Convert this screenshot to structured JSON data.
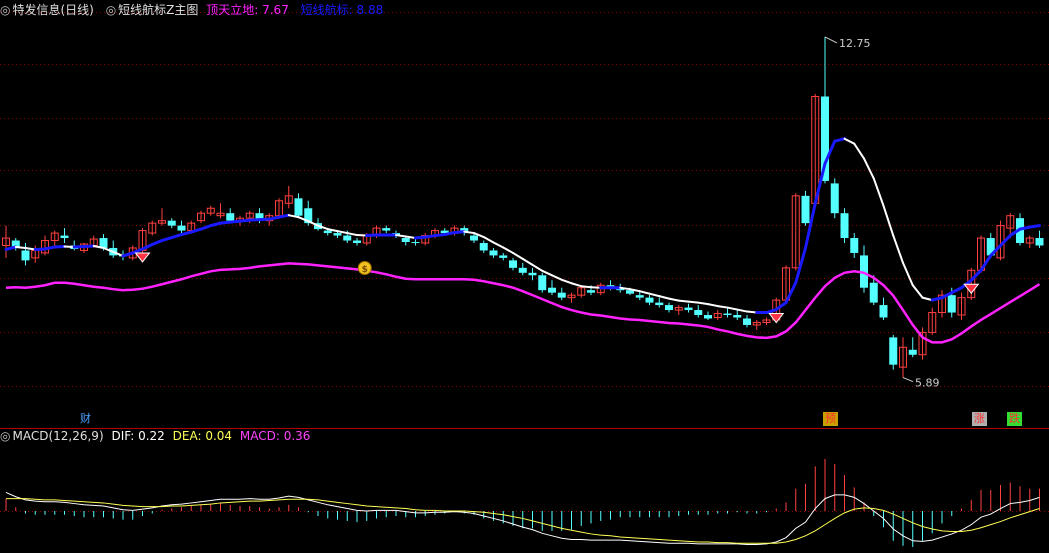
{
  "main_header": {
    "toggle_icon": "circle-toggle-icon",
    "title": "特发信息(日线)",
    "indicator_name": "短线航标Z主图",
    "ttld_label": "顶天立地:",
    "ttld_value": "7.67",
    "dxhb_label": "短线航标:",
    "dxhb_value": "8.88"
  },
  "main_annotations": {
    "high_price": "12.75",
    "low_price": "5.89"
  },
  "signals": {
    "cai": "财",
    "yu": "预",
    "zhang": "涨",
    "die": "跌"
  },
  "macd_header": {
    "toggle_icon": "circle-toggle-icon",
    "title": "MACD(12,26,9)",
    "dif_label": "DIF:",
    "dif_value": "0.22",
    "dea_label": "DEA:",
    "dea_value": "0.04",
    "macd_label": "MACD:",
    "macd_value": "0.36"
  },
  "colors": {
    "up": "#ff4040",
    "down": "#54ffff",
    "grid": "#8b0000",
    "dxhb_blue": "#1a1aff",
    "dxhb_white": "#ffffff",
    "ttld": "#ff22ff",
    "dif": "#ffffff",
    "dea": "#ffff55",
    "macd_label": "#ff44ff"
  },
  "icons": [
    "circle-toggle-icon",
    "diamond-signal-icon",
    "money-bag-icon"
  ],
  "chart_data": [
    {
      "type": "candlestick",
      "ohlc": [
        [
          8.55,
          8.95,
          8.3,
          8.7
        ],
        [
          8.65,
          8.7,
          8.45,
          8.5
        ],
        [
          8.45,
          8.6,
          8.15,
          8.25
        ],
        [
          8.3,
          8.55,
          8.2,
          8.45
        ],
        [
          8.4,
          8.75,
          8.35,
          8.65
        ],
        [
          8.65,
          8.85,
          8.55,
          8.8
        ],
        [
          8.75,
          8.9,
          8.6,
          8.7
        ],
        [
          8.55,
          8.65,
          8.45,
          8.48
        ],
        [
          8.45,
          8.6,
          8.4,
          8.58
        ],
        [
          8.55,
          8.75,
          8.5,
          8.68
        ],
        [
          8.7,
          8.78,
          8.45,
          8.5
        ],
        [
          8.5,
          8.65,
          8.3,
          8.35
        ],
        [
          8.35,
          8.45,
          8.25,
          8.33
        ],
        [
          8.3,
          8.55,
          8.25,
          8.5
        ],
        [
          8.45,
          8.9,
          8.4,
          8.85
        ],
        [
          8.8,
          9.05,
          8.75,
          9.0
        ],
        [
          9.0,
          9.3,
          8.95,
          9.05
        ],
        [
          9.05,
          9.1,
          8.9,
          8.95
        ],
        [
          8.95,
          9.05,
          8.8,
          8.85
        ],
        [
          8.85,
          9.05,
          8.8,
          9.0
        ],
        [
          9.05,
          9.25,
          9.0,
          9.2
        ],
        [
          9.2,
          9.35,
          9.15,
          9.3
        ],
        [
          9.15,
          9.4,
          9.1,
          9.2
        ],
        [
          9.2,
          9.3,
          9.0,
          9.05
        ],
        [
          9.05,
          9.15,
          8.95,
          9.1
        ],
        [
          9.1,
          9.25,
          9.0,
          9.2
        ],
        [
          9.2,
          9.3,
          9.0,
          9.05
        ],
        [
          9.05,
          9.2,
          8.95,
          9.15
        ],
        [
          9.15,
          9.5,
          9.1,
          9.45
        ],
        [
          9.4,
          9.75,
          9.3,
          9.55
        ],
        [
          9.5,
          9.6,
          9.1,
          9.15
        ],
        [
          9.3,
          9.45,
          8.95,
          9.0
        ],
        [
          9.0,
          9.1,
          8.85,
          8.88
        ],
        [
          8.85,
          8.9,
          8.75,
          8.8
        ],
        [
          8.8,
          8.85,
          8.7,
          8.75
        ],
        [
          8.75,
          8.85,
          8.6,
          8.65
        ],
        [
          8.65,
          8.7,
          8.55,
          8.6
        ],
        [
          8.6,
          8.8,
          8.55,
          8.75
        ],
        [
          8.75,
          8.95,
          8.7,
          8.9
        ],
        [
          8.9,
          8.95,
          8.8,
          8.85
        ],
        [
          8.8,
          8.85,
          8.7,
          8.75
        ],
        [
          8.7,
          8.72,
          8.55,
          8.62
        ],
        [
          8.62,
          8.7,
          8.55,
          8.6
        ],
        [
          8.6,
          8.8,
          8.55,
          8.75
        ],
        [
          8.75,
          8.9,
          8.7,
          8.85
        ],
        [
          8.85,
          8.9,
          8.75,
          8.8
        ],
        [
          8.8,
          8.95,
          8.75,
          8.9
        ],
        [
          8.9,
          8.95,
          8.75,
          8.8
        ],
        [
          8.75,
          8.8,
          8.6,
          8.65
        ],
        [
          8.6,
          8.65,
          8.4,
          8.45
        ],
        [
          8.45,
          8.5,
          8.3,
          8.35
        ],
        [
          8.35,
          8.4,
          8.25,
          8.3
        ],
        [
          8.25,
          8.3,
          8.05,
          8.1
        ],
        [
          8.1,
          8.2,
          7.95,
          8.0
        ],
        [
          8.0,
          8.1,
          7.85,
          7.95
        ],
        [
          7.95,
          8.0,
          7.6,
          7.65
        ],
        [
          7.7,
          7.85,
          7.55,
          7.6
        ],
        [
          7.6,
          7.7,
          7.45,
          7.5
        ],
        [
          7.5,
          7.6,
          7.4,
          7.55
        ],
        [
          7.55,
          7.75,
          7.5,
          7.7
        ],
        [
          7.65,
          7.75,
          7.55,
          7.6
        ],
        [
          7.6,
          7.8,
          7.55,
          7.75
        ],
        [
          7.75,
          7.85,
          7.65,
          7.7
        ],
        [
          7.7,
          7.78,
          7.6,
          7.65
        ],
        [
          7.65,
          7.7,
          7.55,
          7.58
        ],
        [
          7.55,
          7.65,
          7.45,
          7.5
        ],
        [
          7.5,
          7.55,
          7.35,
          7.4
        ],
        [
          7.4,
          7.5,
          7.3,
          7.35
        ],
        [
          7.35,
          7.4,
          7.2,
          7.25
        ],
        [
          7.25,
          7.35,
          7.15,
          7.3
        ],
        [
          7.3,
          7.38,
          7.2,
          7.25
        ],
        [
          7.25,
          7.35,
          7.1,
          7.15
        ],
        [
          7.15,
          7.22,
          7.05,
          7.08
        ],
        [
          7.1,
          7.25,
          7.05,
          7.18
        ],
        [
          7.18,
          7.3,
          7.1,
          7.15
        ],
        [
          7.15,
          7.25,
          7.05,
          7.1
        ],
        [
          7.08,
          7.15,
          6.9,
          6.95
        ],
        [
          6.95,
          7.05,
          6.85,
          7.0
        ],
        [
          7.0,
          7.1,
          6.95,
          7.05
        ],
        [
          7.05,
          7.5,
          7.0,
          7.45
        ],
        [
          7.45,
          8.15,
          7.4,
          8.1
        ],
        [
          8.1,
          9.6,
          8.05,
          9.55
        ],
        [
          9.55,
          9.65,
          8.95,
          9.0
        ],
        [
          9.4,
          11.6,
          9.35,
          11.55
        ],
        [
          11.55,
          12.75,
          9.8,
          9.85
        ],
        [
          9.8,
          9.9,
          9.1,
          9.2
        ],
        [
          9.2,
          9.3,
          8.6,
          8.7
        ],
        [
          8.7,
          8.8,
          8.3,
          8.4
        ],
        [
          8.35,
          8.55,
          7.6,
          7.7
        ],
        [
          7.8,
          7.95,
          7.35,
          7.4
        ],
        [
          7.35,
          7.5,
          7.05,
          7.1
        ],
        [
          6.7,
          6.75,
          6.05,
          6.15
        ],
        [
          6.1,
          6.7,
          5.89,
          6.5
        ],
        [
          6.45,
          6.7,
          6.3,
          6.35
        ],
        [
          6.35,
          6.9,
          6.25,
          6.8
        ],
        [
          6.8,
          7.3,
          6.75,
          7.2
        ],
        [
          7.2,
          7.65,
          7.1,
          7.55
        ],
        [
          7.55,
          7.7,
          7.1,
          7.2
        ],
        [
          7.15,
          7.6,
          7.05,
          7.5
        ],
        [
          7.5,
          8.1,
          7.45,
          8.05
        ],
        [
          8.05,
          8.75,
          8.0,
          8.7
        ],
        [
          8.7,
          8.8,
          8.3,
          8.35
        ],
        [
          8.3,
          9.05,
          8.25,
          8.95
        ],
        [
          8.9,
          9.2,
          8.7,
          9.15
        ],
        [
          9.1,
          9.2,
          8.55,
          8.6
        ],
        [
          8.6,
          8.75,
          8.5,
          8.7
        ],
        [
          8.7,
          8.85,
          8.5,
          8.55
        ]
      ],
      "overlays": {
        "短线航标": [
          8.47,
          8.52,
          8.5,
          8.47,
          8.48,
          8.52,
          8.53,
          8.52,
          8.53,
          8.54,
          8.5,
          8.42,
          8.34,
          8.4,
          8.48,
          8.57,
          8.65,
          8.71,
          8.77,
          8.82,
          8.88,
          8.95,
          9.0,
          9.02,
          9.04,
          9.06,
          9.07,
          9.08,
          9.12,
          9.16,
          9.12,
          9.04,
          8.95,
          8.88,
          8.84,
          8.8,
          8.76,
          8.75,
          8.76,
          8.76,
          8.76,
          8.73,
          8.7,
          8.72,
          8.75,
          8.77,
          8.81,
          8.83,
          8.8,
          8.72,
          8.61,
          8.51,
          8.4,
          8.28,
          8.16,
          8.04,
          7.95,
          7.86,
          7.79,
          7.73,
          7.71,
          7.7,
          7.7,
          7.7,
          7.67,
          7.63,
          7.58,
          7.53,
          7.48,
          7.44,
          7.42,
          7.4,
          7.37,
          7.33,
          7.3,
          7.26,
          7.22,
          7.2,
          7.2,
          7.26,
          7.4,
          7.8,
          8.5,
          9.4,
          10.2,
          10.65,
          10.7,
          10.6,
          10.3,
          9.9,
          9.35,
          8.75,
          8.2,
          7.75,
          7.5,
          7.45,
          7.5,
          7.6,
          7.7,
          7.85,
          8.05,
          8.35,
          8.55,
          8.75,
          8.88,
          8.92,
          8.95
        ],
        "顶天立地": [
          7.7,
          7.71,
          7.7,
          7.72,
          7.75,
          7.8,
          7.8,
          7.78,
          7.75,
          7.72,
          7.7,
          7.67,
          7.65,
          7.66,
          7.68,
          7.72,
          7.77,
          7.82,
          7.87,
          7.93,
          7.98,
          8.03,
          8.06,
          8.07,
          8.08,
          8.1,
          8.13,
          8.15,
          8.17,
          8.19,
          8.18,
          8.17,
          8.15,
          8.13,
          8.11,
          8.09,
          8.07,
          8.04,
          8.01,
          7.97,
          7.92,
          7.88,
          7.87,
          7.87,
          7.87,
          7.87,
          7.87,
          7.87,
          7.86,
          7.83,
          7.79,
          7.75,
          7.7,
          7.63,
          7.55,
          7.47,
          7.39,
          7.31,
          7.25,
          7.2,
          7.16,
          7.14,
          7.11,
          7.08,
          7.06,
          7.05,
          7.03,
          7.01,
          6.99,
          6.98,
          6.96,
          6.94,
          6.91,
          6.86,
          6.82,
          6.77,
          6.73,
          6.7,
          6.69,
          6.72,
          6.82,
          7.0,
          7.25,
          7.5,
          7.73,
          7.9,
          8.0,
          8.03,
          8.0,
          7.9,
          7.75,
          7.54,
          7.25,
          6.95,
          6.7,
          6.6,
          6.6,
          6.66,
          6.78,
          6.92,
          7.05,
          7.17,
          7.29,
          7.41,
          7.53,
          7.65,
          7.77
        ]
      },
      "high_annotation": 12.75,
      "low_annotation": 5.89
    },
    {
      "type": "bar",
      "series": [
        {
          "name": "DIF",
          "values": [
            0.3,
            0.23,
            0.18,
            0.16,
            0.15,
            0.15,
            0.14,
            0.12,
            0.1,
            0.09,
            0.08,
            0.05,
            0.02,
            0.01,
            0.03,
            0.05,
            0.08,
            0.1,
            0.11,
            0.13,
            0.15,
            0.17,
            0.19,
            0.19,
            0.19,
            0.2,
            0.19,
            0.19,
            0.21,
            0.24,
            0.22,
            0.18,
            0.14,
            0.1,
            0.07,
            0.04,
            0.01,
            0.0,
            0.01,
            0.01,
            0.01,
            -0.01,
            -0.03,
            -0.03,
            -0.02,
            -0.02,
            -0.01,
            -0.02,
            -0.04,
            -0.08,
            -0.12,
            -0.16,
            -0.21,
            -0.26,
            -0.3,
            -0.36,
            -0.4,
            -0.44,
            -0.46,
            -0.46,
            -0.47,
            -0.47,
            -0.47,
            -0.47,
            -0.48,
            -0.49,
            -0.5,
            -0.51,
            -0.52,
            -0.52,
            -0.52,
            -0.53,
            -0.53,
            -0.53,
            -0.53,
            -0.53,
            -0.54,
            -0.54,
            -0.53,
            -0.5,
            -0.43,
            -0.28,
            -0.18,
            0.04,
            0.2,
            0.26,
            0.26,
            0.22,
            0.12,
            0.0,
            -0.12,
            -0.29,
            -0.4,
            -0.48,
            -0.49,
            -0.47,
            -0.42,
            -0.37,
            -0.31,
            -0.22,
            -0.1,
            -0.05,
            0.04,
            0.12,
            0.14,
            0.17,
            0.22
          ]
        },
        {
          "name": "DEA",
          "values": [
            0.2,
            0.2,
            0.2,
            0.19,
            0.18,
            0.18,
            0.17,
            0.16,
            0.15,
            0.14,
            0.13,
            0.11,
            0.09,
            0.08,
            0.07,
            0.07,
            0.07,
            0.08,
            0.08,
            0.09,
            0.1,
            0.11,
            0.13,
            0.14,
            0.15,
            0.16,
            0.16,
            0.17,
            0.18,
            0.19,
            0.19,
            0.19,
            0.18,
            0.16,
            0.14,
            0.12,
            0.1,
            0.08,
            0.07,
            0.06,
            0.05,
            0.04,
            0.02,
            0.01,
            0.01,
            0.0,
            0.0,
            0.0,
            -0.01,
            -0.02,
            -0.04,
            -0.06,
            -0.09,
            -0.12,
            -0.16,
            -0.2,
            -0.24,
            -0.28,
            -0.31,
            -0.34,
            -0.37,
            -0.39,
            -0.4,
            -0.42,
            -0.43,
            -0.44,
            -0.45,
            -0.46,
            -0.47,
            -0.48,
            -0.49,
            -0.5,
            -0.5,
            -0.51,
            -0.51,
            -0.52,
            -0.52,
            -0.52,
            -0.52,
            -0.52,
            -0.5,
            -0.46,
            -0.4,
            -0.32,
            -0.22,
            -0.12,
            -0.03,
            0.03,
            0.05,
            0.04,
            0.01,
            -0.05,
            -0.12,
            -0.19,
            -0.25,
            -0.29,
            -0.32,
            -0.33,
            -0.33,
            -0.31,
            -0.27,
            -0.22,
            -0.17,
            -0.11,
            -0.06,
            -0.01,
            0.04
          ]
        }
      ]
    }
  ]
}
